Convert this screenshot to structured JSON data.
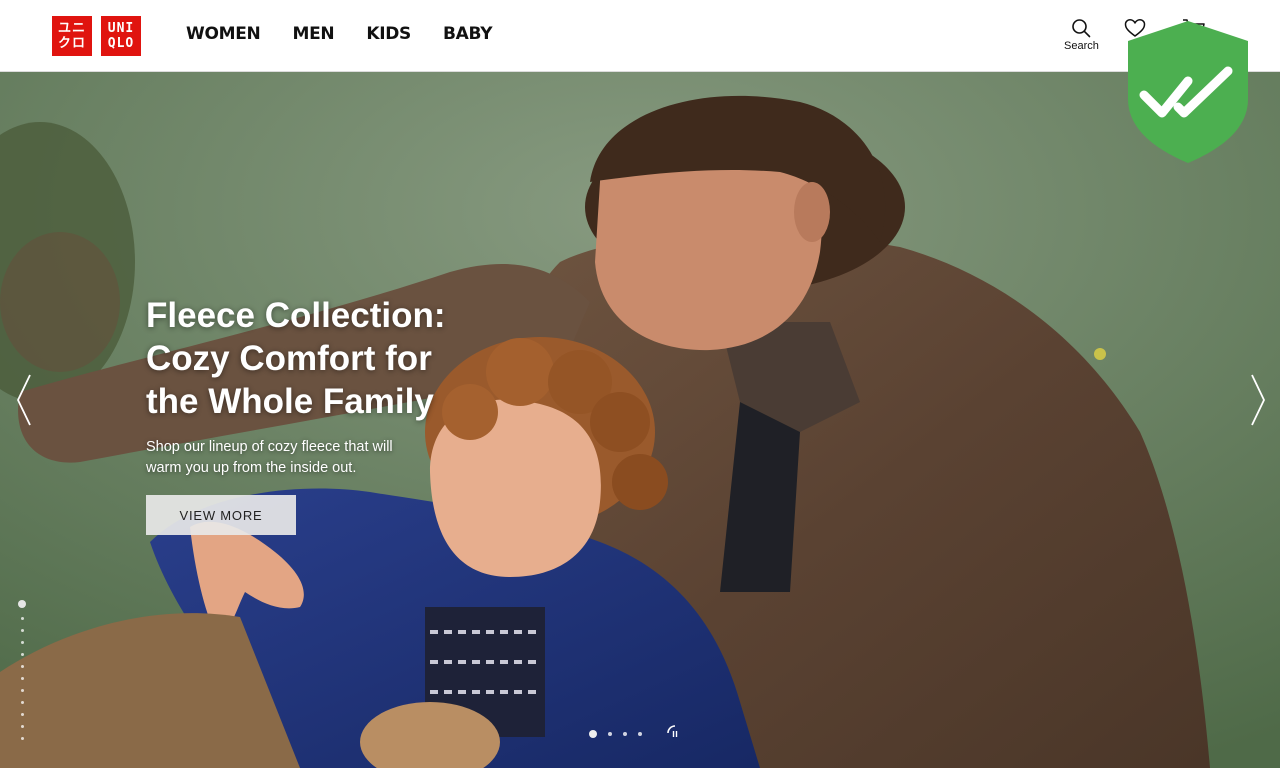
{
  "brand": {
    "logo_lines_left": [
      "ユニ",
      "クロ"
    ],
    "logo_lines_right": [
      "UNI",
      "QLO"
    ],
    "color": "#e0140f"
  },
  "nav": {
    "items": [
      {
        "label": "WOMEN"
      },
      {
        "label": "MEN"
      },
      {
        "label": "KIDS"
      },
      {
        "label": "BABY"
      }
    ]
  },
  "utilities": {
    "search_label": "Search",
    "search_icon": "search-icon",
    "wishlist_icon": "heart-icon",
    "cart_icon": "cart-icon"
  },
  "hero": {
    "title": "Fleece Collection: Cozy Comfort for the Whole Family",
    "subtitle": "Shop our lineup of cozy fleece that will warm you up from the inside out.",
    "cta_label": "VIEW MORE",
    "prev_icon": "chevron-left-icon",
    "next_icon": "chevron-right-icon",
    "vertical_dots_count": 12,
    "vertical_active_index": 0,
    "slide_count": 4,
    "active_slide_index": 0,
    "pause_icon": "pause-icon"
  },
  "badge": {
    "icon": "shield-double-check-icon",
    "color": "#4caf50"
  }
}
